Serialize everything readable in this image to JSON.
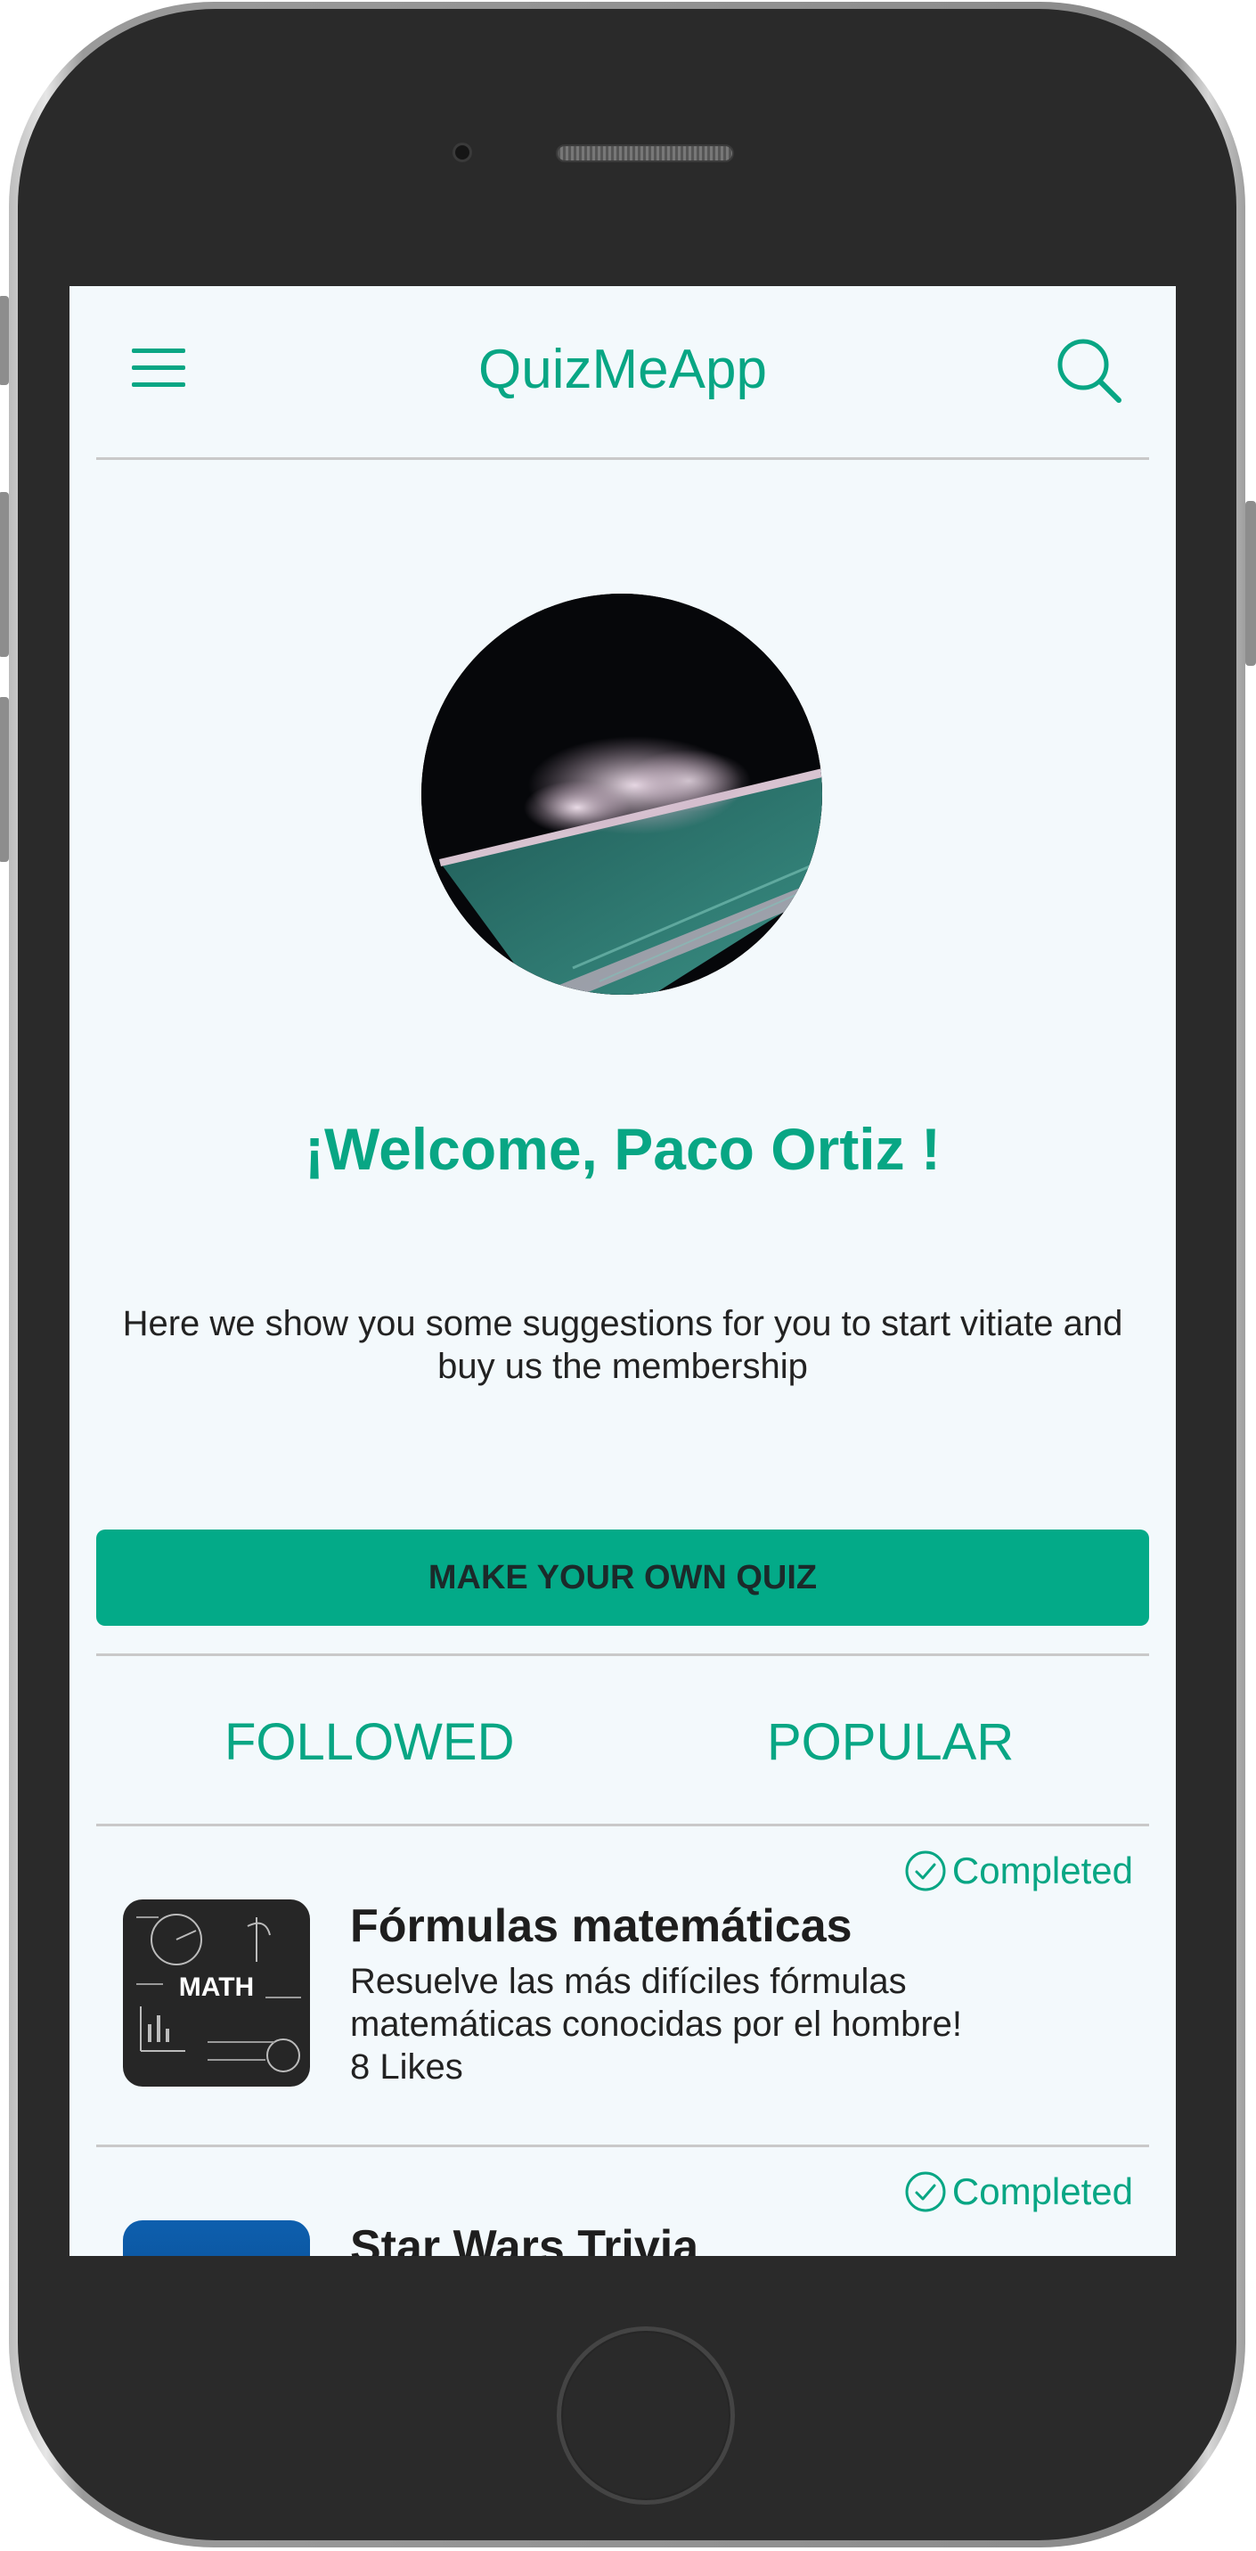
{
  "header": {
    "title": "QuizMeApp",
    "menu_icon": "hamburger-menu-icon",
    "search_icon": "search-icon"
  },
  "profile": {
    "welcome": "¡Welcome, Paco Ortiz !",
    "intro": "Here we show you some suggestions for you to start  vitiate and buy us the membership"
  },
  "actions": {
    "make_quiz_label": "MAKE YOUR OWN QUIZ"
  },
  "tabs": [
    {
      "label": "FOLLOWED"
    },
    {
      "label": "POPULAR"
    }
  ],
  "quizzes": [
    {
      "status": "Completed",
      "title": "Fórmulas matemáticas",
      "description": "Resuelve las más difíciles fórmulas matemáticas conocidas por el hombre!",
      "likes": "8 Likes",
      "thumb_label": "MATH"
    },
    {
      "status": "Completed",
      "title": "Star Wars Trivia"
    }
  ],
  "colors": {
    "accent": "#08a684",
    "button": "#03aa88",
    "screen_bg": "#f3f9fc"
  }
}
